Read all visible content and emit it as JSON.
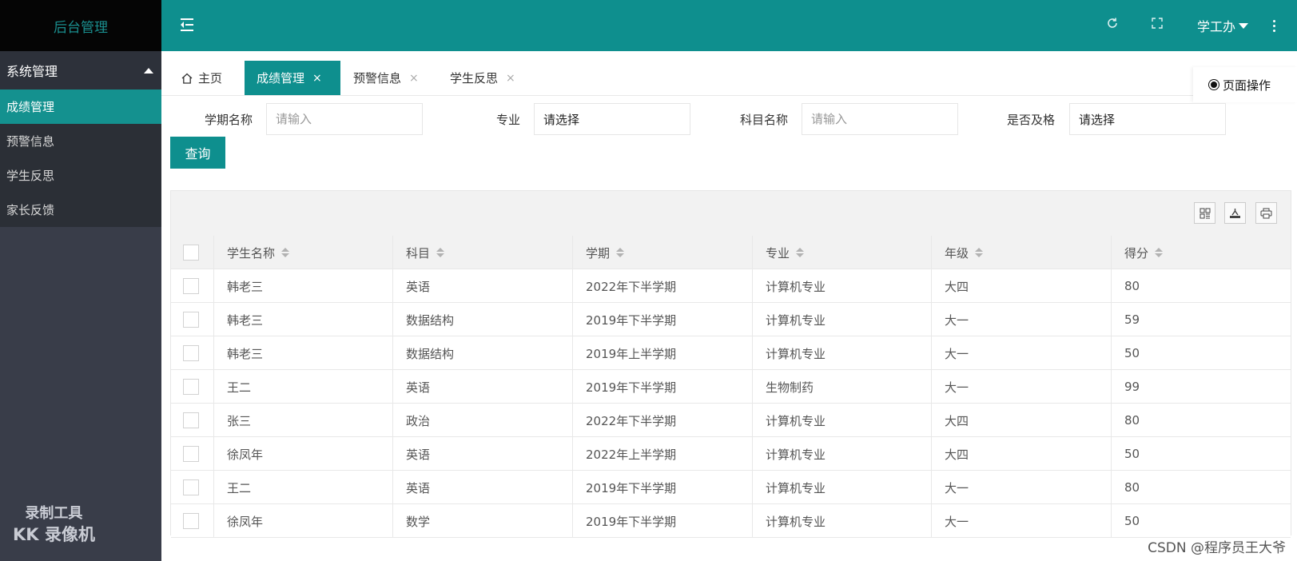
{
  "sidebar": {
    "logo": "后台管理",
    "group_label": "系统管理",
    "items": [
      {
        "label": "成绩管理",
        "active": true
      },
      {
        "label": "预警信息",
        "active": false
      },
      {
        "label": "学生反思",
        "active": false
      },
      {
        "label": "家长反馈",
        "active": false
      }
    ]
  },
  "header": {
    "user": "学工办",
    "icons": [
      "menu-toggle-icon",
      "refresh-icon",
      "fullscreen-icon",
      "more-icon"
    ]
  },
  "tabs": {
    "items": [
      {
        "label": "主页",
        "active": false,
        "closable": false
      },
      {
        "label": "成绩管理",
        "active": true,
        "closable": true
      },
      {
        "label": "预警信息",
        "active": false,
        "closable": true
      },
      {
        "label": "学生反思",
        "active": false,
        "closable": true
      }
    ],
    "close_glyph": "×",
    "page_ops": "页面操作"
  },
  "search": {
    "term_label": "学期名称",
    "term_placeholder": "请输入",
    "major_label": "专业",
    "major_value": "请选择",
    "subject_label": "科目名称",
    "subject_placeholder": "请输入",
    "pass_label": "是否及格",
    "pass_value": "请选择",
    "query_button": "查询"
  },
  "toolbar": {
    "icons": [
      "columns-icon",
      "export-icon",
      "print-icon"
    ]
  },
  "table": {
    "columns": [
      "学生名称",
      "科目",
      "学期",
      "专业",
      "年级",
      "得分"
    ],
    "rows": [
      [
        "韩老三",
        "英语",
        "2022年下半学期",
        "计算机专业",
        "大四",
        "80"
      ],
      [
        "韩老三",
        "数据结构",
        "2019年下半学期",
        "计算机专业",
        "大一",
        "59"
      ],
      [
        "韩老三",
        "数据结构",
        "2019年上半学期",
        "计算机专业",
        "大一",
        "50"
      ],
      [
        "王二",
        "英语",
        "2019年下半学期",
        "生物制药",
        "大一",
        "99"
      ],
      [
        "张三",
        "政治",
        "2022年下半学期",
        "计算机专业",
        "大四",
        "80"
      ],
      [
        "徐凤年",
        "英语",
        "2022年上半学期",
        "计算机专业",
        "大四",
        "50"
      ],
      [
        "王二",
        "英语",
        "2019年下半学期",
        "计算机专业",
        "大一",
        "80"
      ],
      [
        "徐凤年",
        "数学",
        "2019年下半学期",
        "计算机专业",
        "大一",
        "50"
      ]
    ]
  },
  "watermarks": {
    "left_line1": "录制工具",
    "left_line2": "KK 录像机",
    "right": "CSDN @程序员王大爷"
  },
  "colors": {
    "accent": "#0e8f8e",
    "sidebar_bg": "#393d49",
    "logo_bg": "#050505"
  }
}
